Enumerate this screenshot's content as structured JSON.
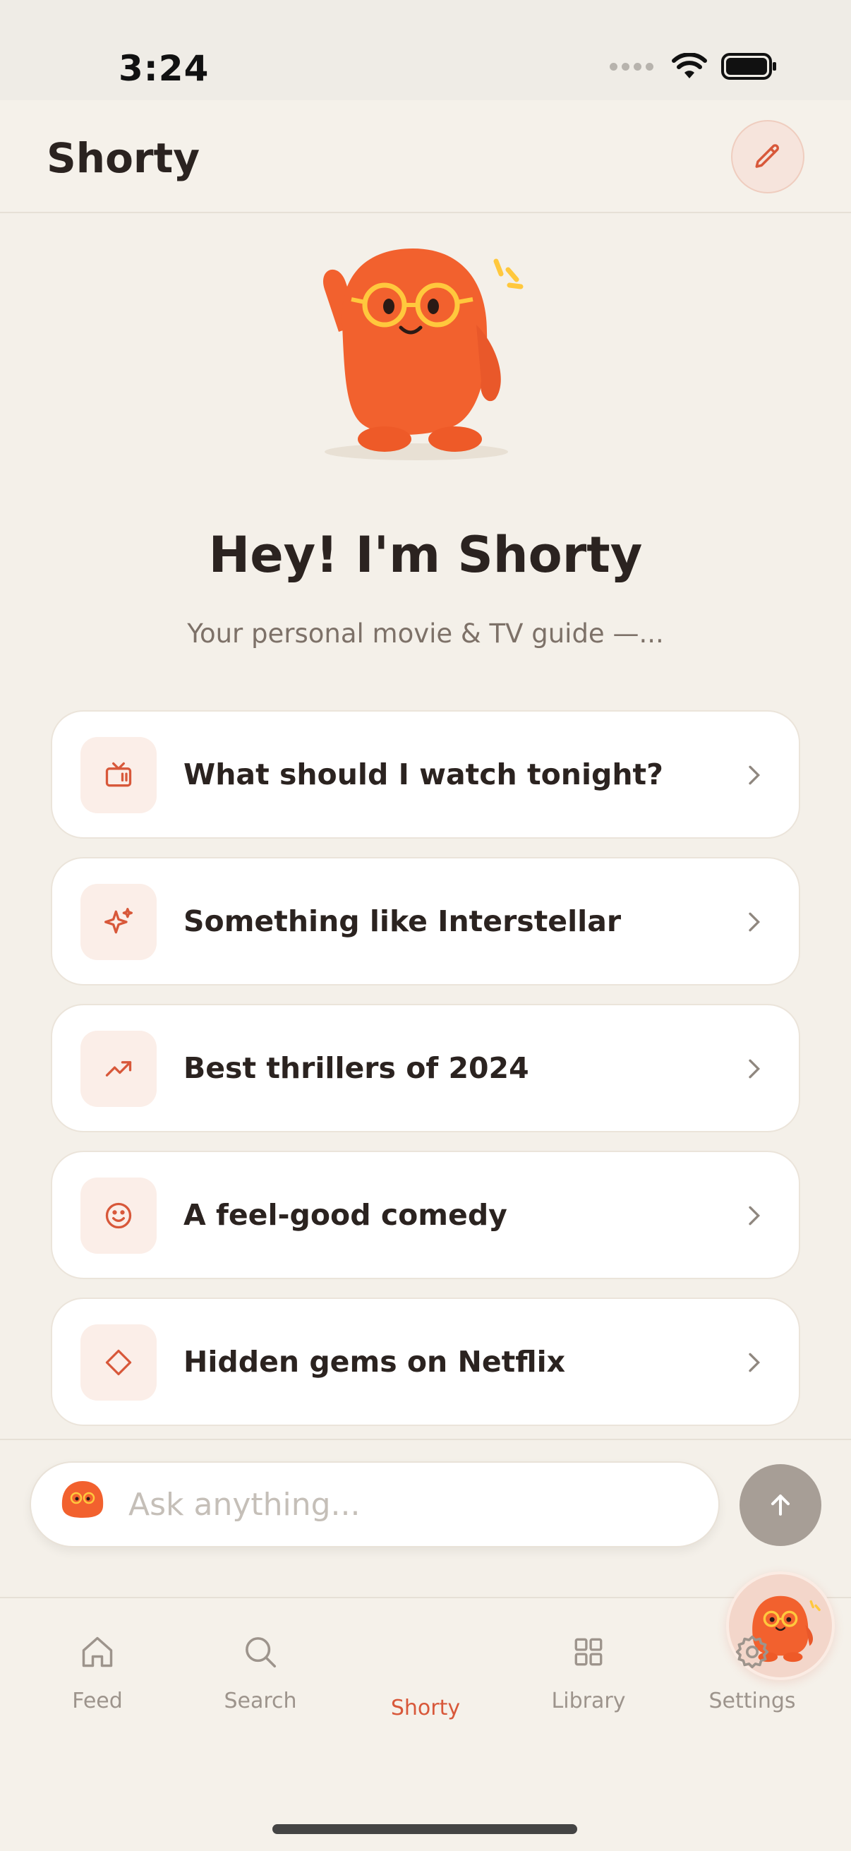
{
  "status_bar": {
    "time": "3:24"
  },
  "header": {
    "title": "Shorty",
    "edit_icon": "pencil-icon"
  },
  "hero": {
    "title": "Hey! I'm Shorty",
    "subtitle": "Your personal movie & TV guide —..."
  },
  "suggestions": [
    {
      "label": "What should I watch tonight?",
      "icon": "tv-icon"
    },
    {
      "label": "Something like Interstellar",
      "icon": "sparkles-icon"
    },
    {
      "label": "Best thrillers of 2024",
      "icon": "trending-up-icon"
    },
    {
      "label": "A feel-good comedy",
      "icon": "smile-icon"
    },
    {
      "label": "Hidden gems on Netflix",
      "icon": "gem-icon"
    }
  ],
  "input": {
    "placeholder": "Ask anything..."
  },
  "tabs": [
    {
      "label": "Feed",
      "icon": "home-icon"
    },
    {
      "label": "Search",
      "icon": "search-icon"
    },
    {
      "label": "Shorty",
      "icon": "shorty-mascot-icon",
      "active": true
    },
    {
      "label": "Library",
      "icon": "grid-icon"
    },
    {
      "label": "Settings",
      "icon": "gear-icon"
    }
  ],
  "colors": {
    "background": "#f4f0e9",
    "accent": "#d8583a",
    "mascot": "#f2612e",
    "text_primary": "#2b2320",
    "text_muted": "#9d948c"
  }
}
